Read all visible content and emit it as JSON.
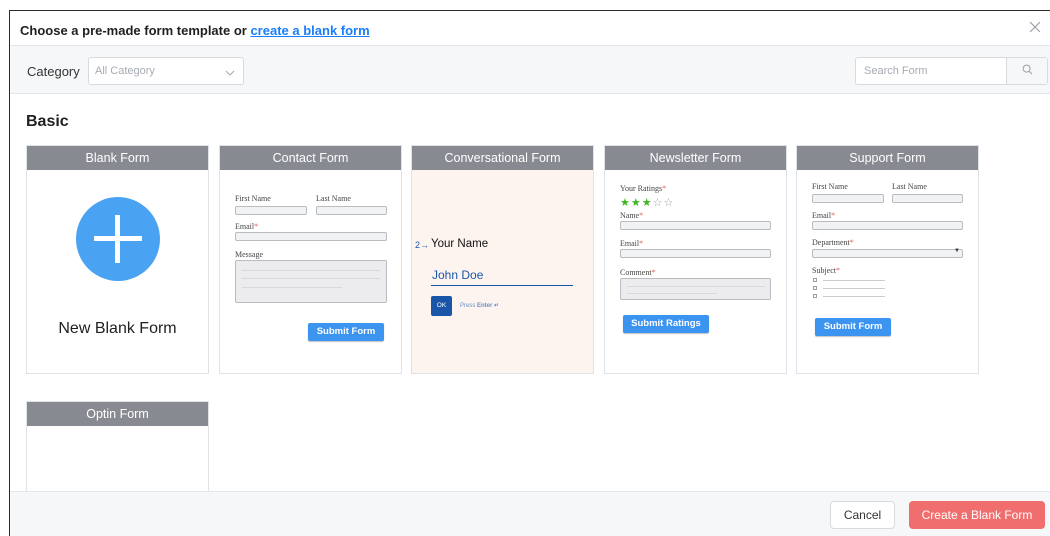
{
  "header": {
    "title_prefix": "Choose a pre-made form template or",
    "title_link": "create a blank form",
    "close_icon": "close-icon"
  },
  "filter": {
    "category_label": "Category",
    "category_value": "All Category",
    "search_placeholder": "Search Form"
  },
  "section_title": "Basic",
  "templates": {
    "blank": {
      "title": "Blank Form",
      "label": "New Blank Form"
    },
    "contact": {
      "title": "Contact Form",
      "first_name": "First Name",
      "last_name": "Last Name",
      "email": "Email",
      "message": "Message",
      "submit": "Submit Form"
    },
    "conversational": {
      "title": "Conversational Form",
      "step": "2→",
      "question": "Your Name",
      "answer": "John Doe",
      "ok": "OK",
      "press": "Press",
      "enter": "Enter ↵"
    },
    "newsletter": {
      "title": "Newsletter Form",
      "ratings": "Your Ratings",
      "rating_value": 3,
      "rating_max": 5,
      "name": "Name",
      "email": "Email",
      "comment": "Comment",
      "submit": "Submit Ratings"
    },
    "support": {
      "title": "Support Form",
      "first_name": "First Name",
      "last_name": "Last Name",
      "email": "Email",
      "department": "Department",
      "subject": "Subject",
      "submit": "Submit Form"
    },
    "optin": {
      "title": "Optin Form"
    }
  },
  "footer": {
    "cancel": "Cancel",
    "create": "Create a Blank Form"
  },
  "colors": {
    "accent": "#1a7efb",
    "primary_button": "#f06e6e",
    "card_header": "#878b91",
    "plus_circle": "#4aa3f2",
    "star": "#3fb51f"
  }
}
